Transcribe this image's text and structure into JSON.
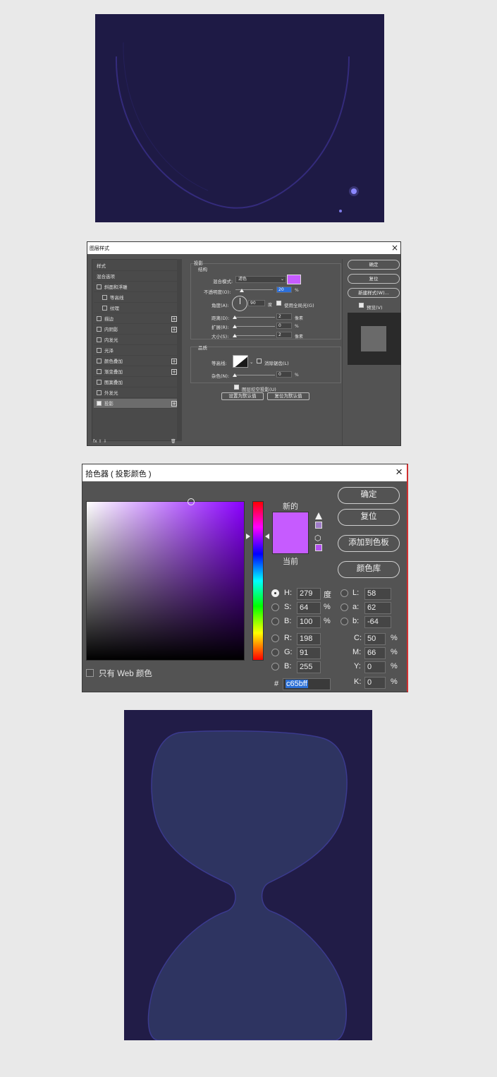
{
  "layer_style": {
    "title": "图层样式",
    "close": "×",
    "styles_list": [
      {
        "label": "样式",
        "checkbox": false,
        "checked": false,
        "plus": false,
        "indent": false
      },
      {
        "label": "混合选项",
        "checkbox": false,
        "checked": false,
        "plus": false,
        "indent": false
      },
      {
        "label": "斜面和浮雕",
        "checkbox": true,
        "checked": false,
        "plus": false,
        "indent": false
      },
      {
        "label": "等高线",
        "checkbox": true,
        "checked": false,
        "plus": false,
        "indent": true
      },
      {
        "label": "纹理",
        "checkbox": true,
        "checked": false,
        "plus": false,
        "indent": true
      },
      {
        "label": "描边",
        "checkbox": true,
        "checked": false,
        "plus": true,
        "indent": false
      },
      {
        "label": "内阴影",
        "checkbox": true,
        "checked": false,
        "plus": true,
        "indent": false
      },
      {
        "label": "内发光",
        "checkbox": true,
        "checked": false,
        "plus": false,
        "indent": false
      },
      {
        "label": "光泽",
        "checkbox": true,
        "checked": false,
        "plus": false,
        "indent": false
      },
      {
        "label": "颜色叠加",
        "checkbox": true,
        "checked": false,
        "plus": true,
        "indent": false
      },
      {
        "label": "渐变叠加",
        "checkbox": true,
        "checked": false,
        "plus": true,
        "indent": false
      },
      {
        "label": "图案叠加",
        "checkbox": true,
        "checked": false,
        "plus": false,
        "indent": false
      },
      {
        "label": "外发光",
        "checkbox": true,
        "checked": false,
        "plus": false,
        "indent": false
      },
      {
        "label": "投影",
        "checkbox": true,
        "checked": true,
        "plus": true,
        "indent": false,
        "selected": true
      }
    ],
    "bottom_icons": "fx  ⇧  ⇩",
    "trash": "🗑",
    "section_title": "投影",
    "structure_title": "结构",
    "blend_mode_label": "混合模式:",
    "blend_mode_value": "滤色",
    "shadow_color": "#c65bff",
    "opacity_label": "不透明度(O):",
    "opacity_value": "20",
    "opacity_unit": "%",
    "angle_label": "角度(A):",
    "angle_value": "90",
    "angle_unit": "度",
    "global_light_label": "使用全局光(G)",
    "distance_label": "距离(D):",
    "distance_value": "2",
    "distance_unit": "像素",
    "spread_label": "扩展(R):",
    "spread_value": "0",
    "spread_unit": "%",
    "size_label": "大小(S):",
    "size_value": "2",
    "size_unit": "像素",
    "quality_title": "品质",
    "contour_label": "等高线:",
    "antialias_label": "消除锯齿(L)",
    "noise_label": "杂色(N):",
    "noise_value": "0",
    "noise_unit": "%",
    "knockout_label": "图层挖空投影(U)",
    "set_default": "设置为默认值",
    "reset_default": "复位为默认值",
    "ok": "确定",
    "reset": "复位",
    "new_style": "新建样式(W)...",
    "preview_label": "预览(V)"
  },
  "color_picker": {
    "title": "拾色器 ( 投影颜色 )",
    "close": "×",
    "new_label": "新的",
    "current_label": "当前",
    "new_color": "#c65bff",
    "ok": "确定",
    "reset": "复位",
    "add_swatch": "添加到色板",
    "color_lib": "颜色库",
    "h_label": "H:",
    "h_value": "279",
    "h_unit": "度",
    "s_label": "S:",
    "s_value": "64",
    "s_unit": "%",
    "b_label": "B:",
    "b_value": "100",
    "b_unit": "%",
    "r_label": "R:",
    "r_value": "198",
    "g_label": "G:",
    "g_value": "91",
    "bb_label": "B:",
    "bb_value": "255",
    "l_label": "L:",
    "l_value": "58",
    "a_label": "a:",
    "a_value": "62",
    "lb_label": "b:",
    "lb_value": "-64",
    "c_label": "C:",
    "c_value": "50",
    "c_unit": "%",
    "m_label": "M:",
    "m_value": "66",
    "m_unit": "%",
    "y_label": "Y:",
    "y_value": "0",
    "y_unit": "%",
    "k_label": "K:",
    "k_value": "0",
    "k_unit": "%",
    "hex_label": "#",
    "hex_value": "c65bff",
    "web_only_label": "只有 Web 颜色"
  }
}
